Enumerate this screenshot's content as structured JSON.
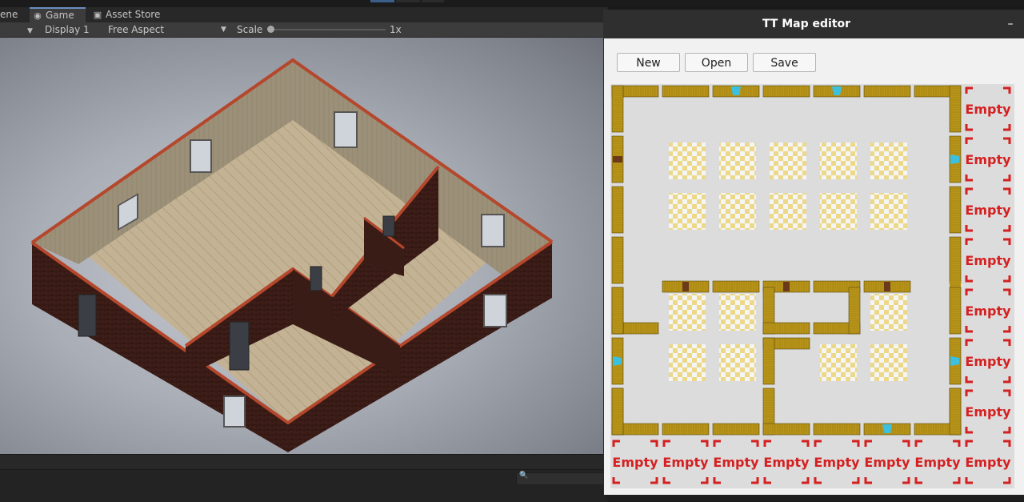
{
  "unity": {
    "tabs": [
      {
        "label": "ene",
        "icon": "scene-icon"
      },
      {
        "label": "Game",
        "icon": "gamepad-icon"
      },
      {
        "label": "Asset Store",
        "icon": "lock-icon"
      }
    ],
    "toolbar": {
      "display": "Display 1",
      "aspect": "Free Aspect",
      "scale_label": "Scale",
      "scale_value": "1x"
    }
  },
  "editor": {
    "title": "TT Map editor",
    "minimize_label": "–",
    "buttons": {
      "new": "New",
      "open": "Open",
      "save": "Save"
    },
    "empty_label": "Empty",
    "colors": {
      "wall": "#b89419",
      "empty_text": "#d42020",
      "window": "#3cc0e0",
      "door": "#6a3a1a",
      "floor_tile": "#ecd889"
    }
  }
}
